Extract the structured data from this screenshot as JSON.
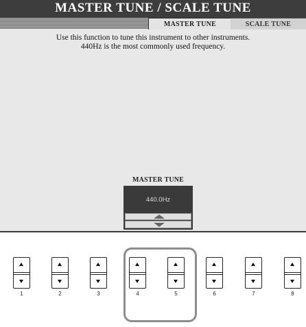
{
  "screen": {
    "title": "MASTER TUNE / SCALE TUNE",
    "tabs": [
      {
        "label": "MASTER TUNE",
        "active": true
      },
      {
        "label": "SCALE TUNE",
        "active": false
      }
    ],
    "description_line1": "Use this function to tune this instrument to other instruments.",
    "description_line2": "440Hz is the most commonly used frequency.",
    "master_tune": {
      "label": "MASTER TUNE",
      "value": "440.0Hz"
    }
  },
  "buttons": [
    {
      "number": "1"
    },
    {
      "number": "2"
    },
    {
      "number": "3"
    },
    {
      "number": "4"
    },
    {
      "number": "5"
    },
    {
      "number": "6"
    },
    {
      "number": "7"
    },
    {
      "number": "8"
    }
  ],
  "highlighted_buttons": [
    "4",
    "5"
  ],
  "colors": {
    "title_bar": "#3d3d3d",
    "screen_bg": "#e4e4e4",
    "highlight_outline": "#8c8c8c"
  }
}
